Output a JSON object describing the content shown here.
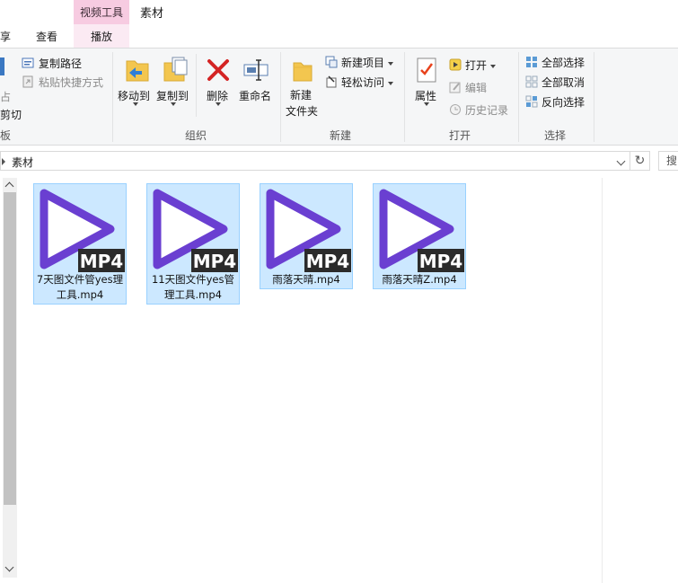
{
  "tabs": {
    "context_group": "视频工具",
    "title": "素材",
    "share": "享",
    "view": "查看",
    "play": "播放"
  },
  "ribbon": {
    "clipboard": {
      "copy_path": "复制路径",
      "paste_shortcut": "粘贴快捷方式",
      "cut_fragment": "剪切",
      "fragment_top": "占",
      "label": "板"
    },
    "organize": {
      "move_to": "移动到",
      "copy_to": "复制到",
      "delete": "删除",
      "rename": "重命名",
      "label": "组织"
    },
    "new": {
      "new_folder_line1": "新建",
      "new_folder_line2": "文件夹",
      "new_item": "新建项目",
      "easy_access": "轻松访问",
      "label": "新建"
    },
    "open": {
      "properties": "属性",
      "open": "打开",
      "edit": "编辑",
      "history": "历史记录",
      "label": "打开"
    },
    "select": {
      "select_all": "全部选择",
      "select_none": "全部取消",
      "invert": "反向选择",
      "label": "选择"
    }
  },
  "address": {
    "path": "素材",
    "search_placeholder": "搜"
  },
  "files": [
    {
      "name": "7天图文件管yes理工具.mp4",
      "badge": "MP4"
    },
    {
      "name": "11天图文件yes管理工具.mp4",
      "badge": "MP4"
    },
    {
      "name": "雨落天晴.mp4",
      "badge": "MP4"
    },
    {
      "name": "雨落天晴Z.mp4",
      "badge": "MP4"
    }
  ],
  "colors": {
    "accent": "#6a3fd1",
    "selection": "#cce8ff",
    "context_tab": "#f7cbe1"
  }
}
